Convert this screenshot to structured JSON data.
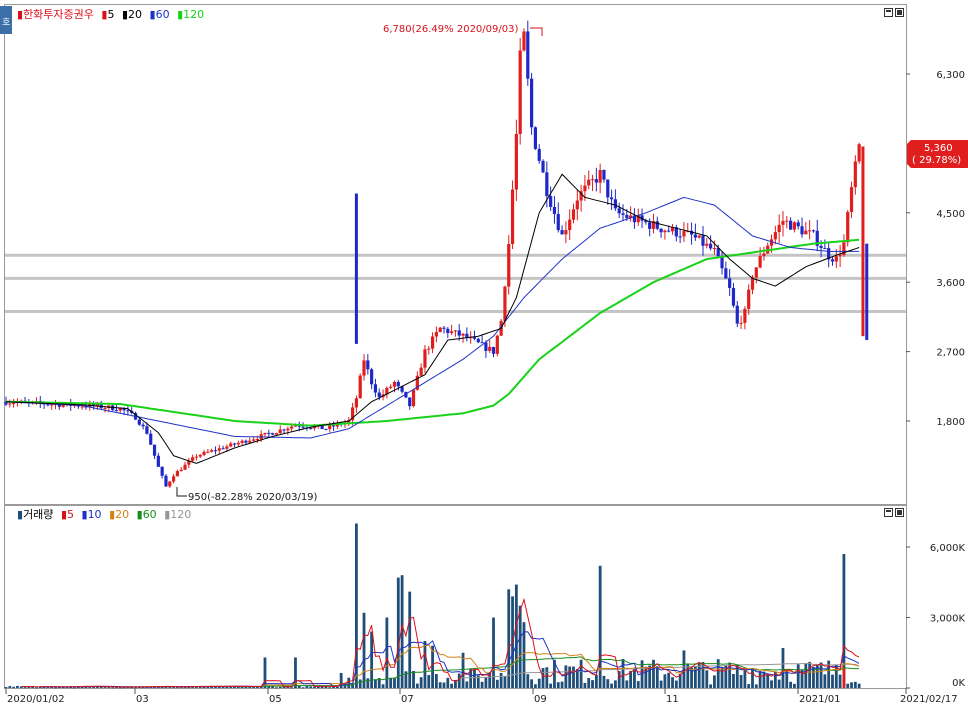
{
  "chart_data": [
    {
      "type": "candlestick",
      "title": "한화투자증권우",
      "legend": [
        {
          "label": "5",
          "color": "#d9101a"
        },
        {
          "label": "20",
          "color": "#000000"
        },
        {
          "label": "60",
          "color": "#1e32c8"
        },
        {
          "label": "120",
          "color": "#19d219"
        }
      ],
      "y_ticks": [
        1800,
        2700,
        3600,
        4500,
        6300
      ],
      "y_tick_labels": [
        "1,800",
        "2,700",
        "3,600",
        "4,500",
        "6,300"
      ],
      "ylim": [
        800,
        7000
      ],
      "support_lines": [
        3950,
        3650,
        3220
      ],
      "current_price_label": "5,360",
      "current_change_label": "( 29.78%)",
      "max_annotation": "6,780(26.49% 2020/09/03)",
      "min_annotation": "950(-82.28% 2020/03/19)",
      "price_path": [
        [
          0,
          2050
        ],
        [
          12,
          2020
        ],
        [
          24,
          1990
        ],
        [
          30,
          1960
        ],
        [
          34,
          1850
        ],
        [
          37,
          1650
        ],
        [
          40,
          1200
        ],
        [
          42,
          950
        ],
        [
          44,
          1100
        ],
        [
          50,
          1350
        ],
        [
          60,
          1500
        ],
        [
          70,
          1650
        ],
        [
          76,
          1750
        ],
        [
          84,
          1700
        ],
        [
          90,
          1800
        ],
        [
          92,
          2100
        ],
        [
          94,
          2600
        ],
        [
          96,
          2300
        ],
        [
          98,
          2100
        ],
        [
          102,
          2300
        ],
        [
          106,
          2000
        ],
        [
          110,
          2700
        ],
        [
          114,
          3000
        ],
        [
          120,
          2900
        ],
        [
          124,
          2800
        ],
        [
          128,
          2700
        ],
        [
          130,
          3100
        ],
        [
          132,
          4100
        ],
        [
          134,
          5500
        ],
        [
          135,
          6500
        ],
        [
          136,
          6780
        ],
        [
          138,
          5600
        ],
        [
          142,
          4800
        ],
        [
          146,
          4200
        ],
        [
          150,
          4700
        ],
        [
          156,
          5000
        ],
        [
          160,
          4500
        ],
        [
          166,
          4400
        ],
        [
          172,
          4300
        ],
        [
          180,
          4200
        ],
        [
          186,
          4000
        ],
        [
          190,
          3500
        ],
        [
          192,
          3050
        ],
        [
          194,
          3200
        ],
        [
          196,
          3700
        ],
        [
          200,
          4100
        ],
        [
          204,
          4400
        ],
        [
          208,
          4300
        ],
        [
          212,
          4200
        ],
        [
          216,
          3950
        ],
        [
          218,
          3900
        ],
        [
          220,
          4100
        ],
        [
          222,
          4800
        ],
        [
          224,
          5360
        ]
      ],
      "ma_paths": {
        "ma20": [
          [
            0,
            2050
          ],
          [
            20,
            2010
          ],
          [
            32,
            1960
          ],
          [
            40,
            1650
          ],
          [
            44,
            1350
          ],
          [
            50,
            1250
          ],
          [
            60,
            1450
          ],
          [
            70,
            1600
          ],
          [
            80,
            1720
          ],
          [
            90,
            1800
          ],
          [
            96,
            2050
          ],
          [
            102,
            2200
          ],
          [
            110,
            2400
          ],
          [
            116,
            2850
          ],
          [
            124,
            2900
          ],
          [
            130,
            3000
          ],
          [
            134,
            3400
          ],
          [
            140,
            4500
          ],
          [
            146,
            5000
          ],
          [
            152,
            4700
          ],
          [
            160,
            4600
          ],
          [
            168,
            4400
          ],
          [
            176,
            4300
          ],
          [
            184,
            4200
          ],
          [
            190,
            3900
          ],
          [
            196,
            3650
          ],
          [
            202,
            3550
          ],
          [
            210,
            3800
          ],
          [
            218,
            3950
          ],
          [
            224,
            4050
          ]
        ],
        "ma60": [
          [
            0,
            2050
          ],
          [
            20,
            2000
          ],
          [
            40,
            1800
          ],
          [
            60,
            1600
          ],
          [
            80,
            1580
          ],
          [
            90,
            1700
          ],
          [
            100,
            2000
          ],
          [
            110,
            2300
          ],
          [
            120,
            2600
          ],
          [
            128,
            2900
          ],
          [
            136,
            3400
          ],
          [
            146,
            3900
          ],
          [
            156,
            4300
          ],
          [
            168,
            4500
          ],
          [
            178,
            4700
          ],
          [
            186,
            4600
          ],
          [
            196,
            4200
          ],
          [
            206,
            4050
          ],
          [
            216,
            4000
          ],
          [
            224,
            4000
          ]
        ],
        "ma120": [
          [
            0,
            2050
          ],
          [
            30,
            2020
          ],
          [
            60,
            1800
          ],
          [
            80,
            1740
          ],
          [
            100,
            1800
          ],
          [
            120,
            1900
          ],
          [
            128,
            2000
          ],
          [
            132,
            2150
          ],
          [
            140,
            2600
          ],
          [
            156,
            3200
          ],
          [
            170,
            3600
          ],
          [
            184,
            3900
          ],
          [
            198,
            4000
          ],
          [
            212,
            4100
          ],
          [
            224,
            4150
          ]
        ]
      },
      "vertical_spikes": [
        {
          "x": 92,
          "low": 2800,
          "high": 4750,
          "color": "#1e28c8"
        },
        {
          "x": 225,
          "low": 2900,
          "high": 5360,
          "color": "#e11e1e"
        },
        {
          "x": 226,
          "low": 2850,
          "high": 4100,
          "color": "#1e28c8"
        }
      ]
    },
    {
      "type": "bar",
      "title": "거래량",
      "legend": [
        {
          "label": "5",
          "color": "#d9101a"
        },
        {
          "label": "10",
          "color": "#1e32c8"
        },
        {
          "label": "20",
          "color": "#d28214"
        },
        {
          "label": "60",
          "color": "#198c19"
        },
        {
          "label": "120",
          "color": "#969696"
        }
      ],
      "y_ticks": [
        0,
        3000000,
        6000000
      ],
      "y_tick_labels": [
        "0K",
        "3,000K",
        "6,000K"
      ],
      "ylim": [
        0,
        7500000
      ],
      "x_tick_labels": [
        "2020/01/02",
        "03",
        "05",
        "07",
        "09",
        "11",
        "2021/01",
        "2021/02/17"
      ],
      "big_bars": [
        [
          92,
          7000000
        ],
        [
          94,
          3200000
        ],
        [
          96,
          2400000
        ],
        [
          100,
          3000000
        ],
        [
          103,
          4700000
        ],
        [
          104,
          4800000
        ],
        [
          106,
          4100000
        ],
        [
          110,
          2000000
        ],
        [
          112,
          1800000
        ],
        [
          120,
          1500000
        ],
        [
          128,
          3000000
        ],
        [
          132,
          4200000
        ],
        [
          133,
          3900000
        ],
        [
          134,
          4400000
        ],
        [
          135,
          3500000
        ],
        [
          136,
          2800000
        ],
        [
          156,
          5200000
        ],
        [
          178,
          1600000
        ],
        [
          204,
          1700000
        ],
        [
          218,
          1000000
        ],
        [
          220,
          5700000
        ]
      ]
    }
  ]
}
